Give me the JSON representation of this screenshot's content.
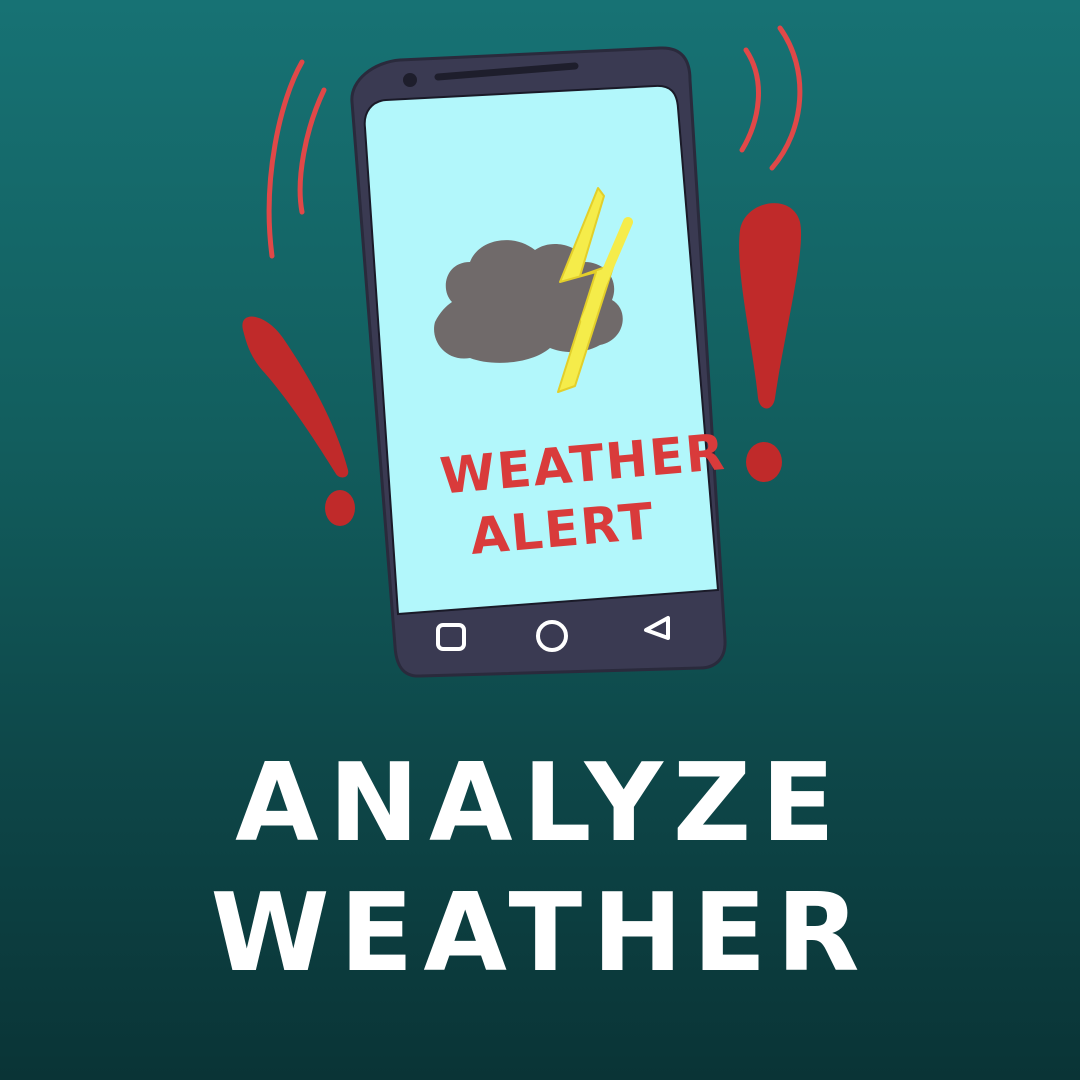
{
  "phone_screen": {
    "alert_line_1": "WEATHER",
    "alert_line_2": "ALERT",
    "icons": [
      "storm-cloud-icon",
      "lightning-bolt-icon"
    ],
    "nav_icons": [
      "recent-apps-icon",
      "home-icon",
      "back-icon"
    ]
  },
  "headline": {
    "line_1": "ANALYZE",
    "line_2": "WEATHER"
  },
  "colors": {
    "background_top": "#177274",
    "background_bottom": "#0a3436",
    "phone_body": "#3a3a52",
    "phone_screen": "#b2f7fb",
    "cloud": "#706a6a",
    "lightning": "#f5ec4a",
    "alert_red": "#d93b3b",
    "exclamation_red": "#c02a2a",
    "headline_text": "#ffffff"
  }
}
